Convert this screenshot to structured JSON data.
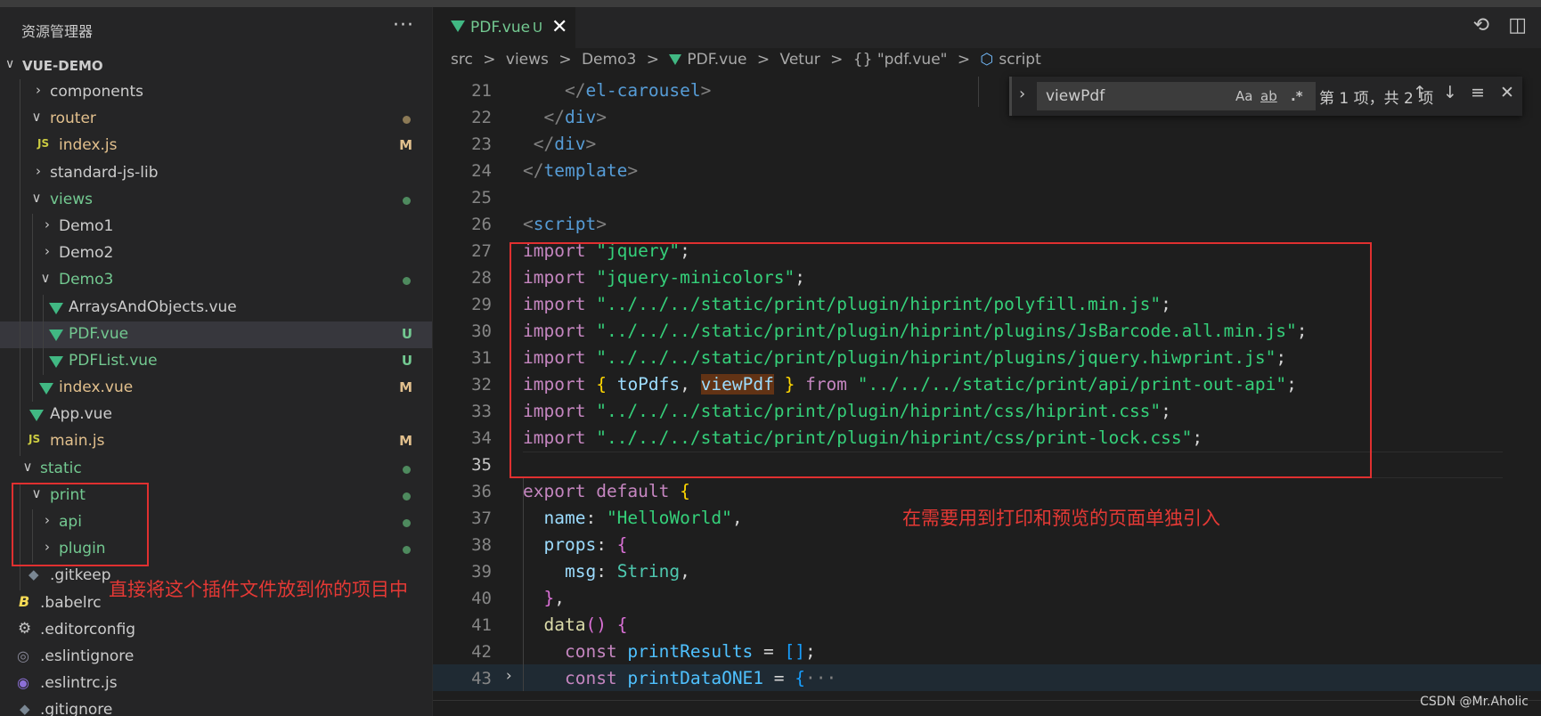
{
  "sidebar": {
    "title": "资源管理器",
    "more": "···",
    "project": "VUE-DEMO",
    "annotation": "直接将这个插件文件放到你的项目中",
    "items": [
      {
        "label": "components",
        "badge": "",
        "dot": ""
      },
      {
        "label": "router",
        "badge": "",
        "dot": "yellow"
      },
      {
        "label": "index.js",
        "badge": "M",
        "dot": ""
      },
      {
        "label": "standard-js-lib",
        "badge": "",
        "dot": ""
      },
      {
        "label": "views",
        "badge": "",
        "dot": "green"
      },
      {
        "label": "Demo1",
        "badge": "",
        "dot": ""
      },
      {
        "label": "Demo2",
        "badge": "",
        "dot": ""
      },
      {
        "label": "Demo3",
        "badge": "",
        "dot": "green"
      },
      {
        "label": "ArraysAndObjects.vue",
        "badge": "",
        "dot": ""
      },
      {
        "label": "PDF.vue",
        "badge": "U",
        "dot": ""
      },
      {
        "label": "PDFList.vue",
        "badge": "U",
        "dot": ""
      },
      {
        "label": "index.vue",
        "badge": "M",
        "dot": ""
      },
      {
        "label": "App.vue",
        "badge": "",
        "dot": ""
      },
      {
        "label": "main.js",
        "badge": "M",
        "dot": ""
      },
      {
        "label": "static",
        "badge": "",
        "dot": "green"
      },
      {
        "label": "print",
        "badge": "",
        "dot": "green"
      },
      {
        "label": "api",
        "badge": "",
        "dot": "green"
      },
      {
        "label": "plugin",
        "badge": "",
        "dot": "green"
      },
      {
        "label": ".gitkeep",
        "badge": "",
        "dot": ""
      },
      {
        "label": ".babelrc",
        "badge": "",
        "dot": ""
      },
      {
        "label": ".editorconfig",
        "badge": "",
        "dot": ""
      },
      {
        "label": ".eslintignore",
        "badge": "",
        "dot": ""
      },
      {
        "label": ".eslintrc.js",
        "badge": "",
        "dot": ""
      },
      {
        "label": ".gitignore",
        "badge": "",
        "dot": ""
      }
    ]
  },
  "tab": {
    "name": "PDF.vue",
    "status": "U",
    "close": "✕"
  },
  "breadcrumb": [
    "src",
    "views",
    "Demo3",
    "PDF.vue",
    "Vetur",
    "{} \"pdf.vue\"",
    "script"
  ],
  "breadcrumb_sep": ">",
  "find": {
    "value": "viewPdf",
    "opt_case": "Aa",
    "opt_word": "ab",
    "opt_regex": ".*",
    "count": "第 1 项，共 2 项"
  },
  "editor": {
    "annotation": "在需要用到打印和预览的页面单独引入",
    "line_numbers": [
      "21",
      "22",
      "23",
      "24",
      "25",
      "26",
      "27",
      "28",
      "29",
      "30",
      "31",
      "32",
      "33",
      "34",
      "35",
      "36",
      "37",
      "38",
      "39",
      "40",
      "41",
      "42",
      "43"
    ],
    "imports": {
      "l27": "\"jquery\"",
      "l28": "\"jquery-minicolors\"",
      "l29": "\"../../../static/print/plugin/hiprint/polyfill.min.js\"",
      "l30": "\"../../../static/print/plugin/hiprint/plugins/JsBarcode.all.min.js\"",
      "l31": "\"../../../static/print/plugin/hiprint/plugins/jquery.hiwprint.js\"",
      "l32_a": "toPdfs",
      "l32_b": "viewPdf",
      "l32_path": "\"../../../static/print/api/print-out-api\"",
      "l33": "\"../../../static/print/plugin/hiprint/css/hiprint.css\"",
      "l34": "\"../../../static/print/plugin/hiprint/css/print-lock.css\""
    },
    "tags": {
      "carousel": "el-carousel",
      "div": "div",
      "template": "template",
      "script": "script"
    },
    "kw": {
      "import": "import",
      "from": "from",
      "export": "export",
      "default": "default",
      "const": "const"
    },
    "obj": {
      "name_key": "name",
      "name_val": "\"HelloWorld\"",
      "props_key": "props",
      "msg_key": "msg",
      "msg_type": "String",
      "data_fn": "data",
      "var1": "printResults",
      "var2": "printDataONE1",
      "ellipsis": "···"
    }
  },
  "watermark": "CSDN @Mr.Aholic"
}
